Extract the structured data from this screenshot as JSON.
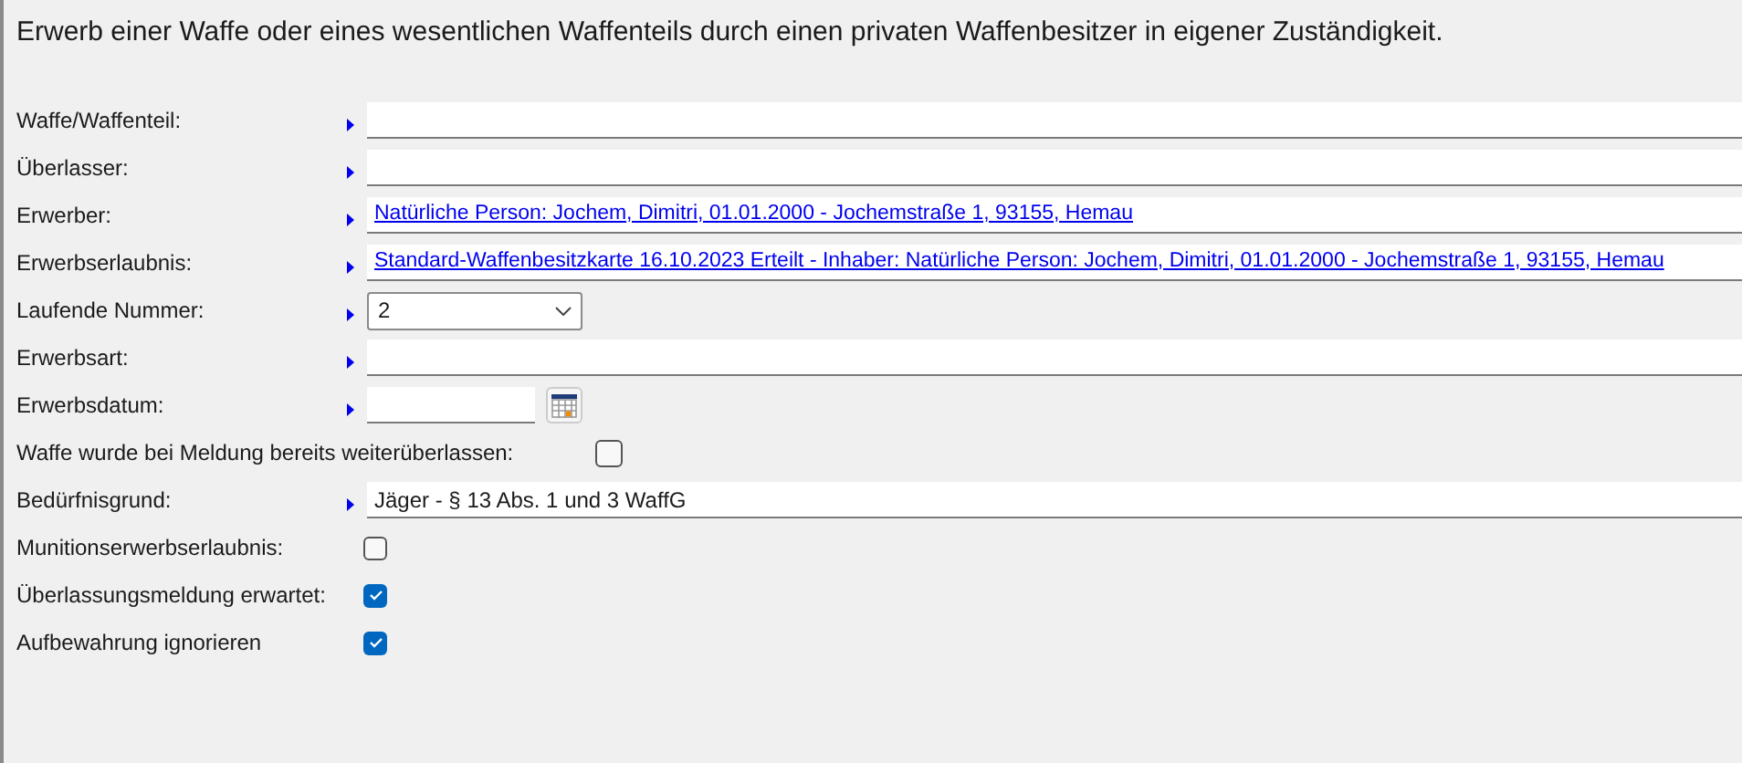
{
  "title": "Erwerb einer Waffe oder eines wesentlichen Waffenteils durch einen privaten Waffenbesitzer in eigener Zuständigkeit.",
  "fields": [
    {
      "kind": "text",
      "label": "Waffe/Waffenteil:"
    },
    {
      "kind": "text",
      "label": "Überlasser:"
    },
    {
      "kind": "link",
      "label": "Erwerber:",
      "value": "Natürliche Person: Jochem, Dimitri, 01.01.2000 - Jochemstraße 1, 93155, Hemau"
    },
    {
      "kind": "link",
      "label": "Erwerbserlaubnis:",
      "value": "Standard-Waffenbesitzkarte 16.10.2023 Erteilt - Inhaber: Natürliche Person: Jochem, Dimitri, 01.01.2000 - Jochemstraße 1, 93155, Hemau"
    },
    {
      "kind": "select",
      "label": "Laufende Nummer:",
      "value": "2"
    },
    {
      "kind": "text",
      "label": "Erwerbsart:"
    },
    {
      "kind": "date",
      "label": "Erwerbsdatum:"
    },
    {
      "kind": "checkbox",
      "label": "Waffe wurde bei Meldung bereits weiterüberlassen:",
      "checked": false
    },
    {
      "kind": "text",
      "label": "Bedürfnisgrund:",
      "value": "Jäger - § 13 Abs. 1 und 3 WaffG"
    },
    {
      "kind": "checkbox",
      "label": "Munitionserwerbserlaubnis:",
      "checked": false
    },
    {
      "kind": "checkbox",
      "label": "Überlassungsmeldung erwartet:",
      "checked": true
    },
    {
      "kind": "checkbox",
      "label": "Aufbewahrung ignorieren",
      "checked": true
    }
  ]
}
